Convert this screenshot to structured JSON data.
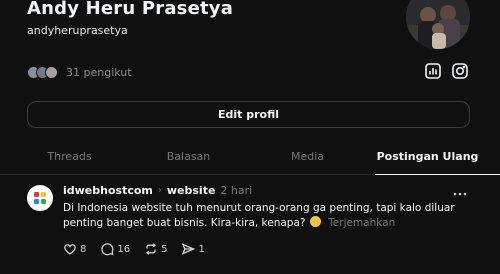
{
  "profile": {
    "name": "Andy Heru Prasetya",
    "handle": "andyheruprasetya",
    "followers_text": "31 pengikut",
    "edit_label": "Edit profil"
  },
  "tabs": [
    {
      "label": "Threads",
      "active": false
    },
    {
      "label": "Balasan",
      "active": false
    },
    {
      "label": "Media",
      "active": false
    },
    {
      "label": "Postingan Ulang",
      "active": true
    }
  ],
  "post": {
    "author": "idwebhostcom",
    "topic": "website",
    "time": "2 hari",
    "text": "Di Indonesia website tuh menurut orang-orang ga penting, tapi kalo diluar penting banget buat bisnis. Kira-kira, kenapa?",
    "translate_label": "Terjemahkan",
    "likes": "8",
    "comments": "16",
    "reposts": "5",
    "shares": "1"
  },
  "icons": {
    "stats": "insights-icon",
    "instagram": "instagram-icon",
    "more": "more-icon",
    "like": "heart-icon",
    "comment": "comment-icon",
    "repost": "repost-icon",
    "share": "send-icon"
  },
  "colors": {
    "background": "#101010",
    "text": "#f3f5f7",
    "muted": "#777777",
    "border": "#3a3a3a"
  }
}
